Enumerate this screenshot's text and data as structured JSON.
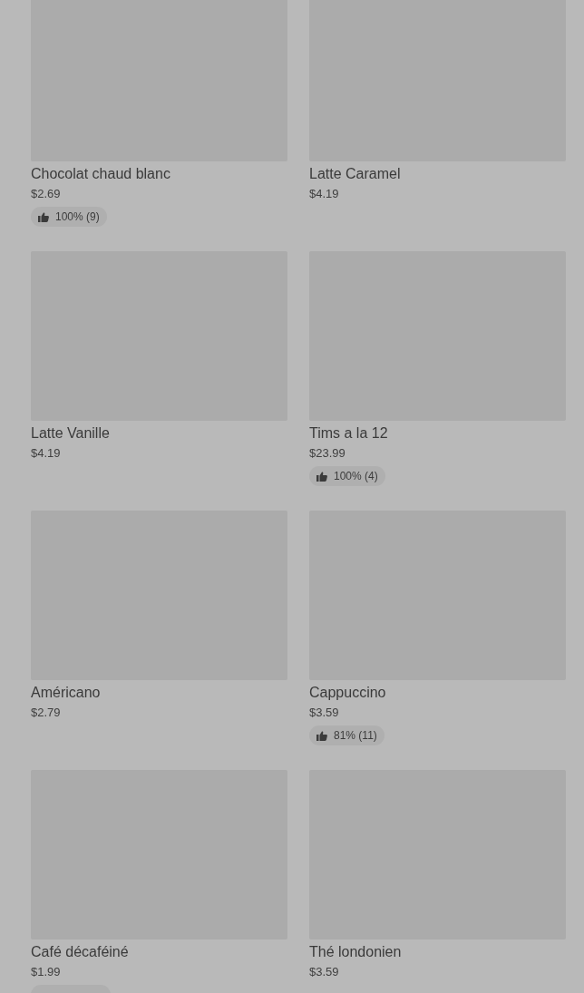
{
  "products": [
    {
      "name": "Chocolat chaud blanc",
      "price": "$2.69",
      "rating": "100% (9)"
    },
    {
      "name": "Latte Caramel",
      "price": "$4.19"
    },
    {
      "name": "Latte Vanille",
      "price": "$4.19"
    },
    {
      "name": "Tims a la 12",
      "price": "$23.99",
      "rating": "100% (4)"
    },
    {
      "name": "Américano",
      "price": "$2.79"
    },
    {
      "name": "Cappuccino",
      "price": "$3.59",
      "rating": "81% (11)"
    },
    {
      "name": "Café décaféiné",
      "price": "$1.99",
      "rating_cut": true
    },
    {
      "name": "Thé londonien",
      "price": "$3.59"
    }
  ]
}
